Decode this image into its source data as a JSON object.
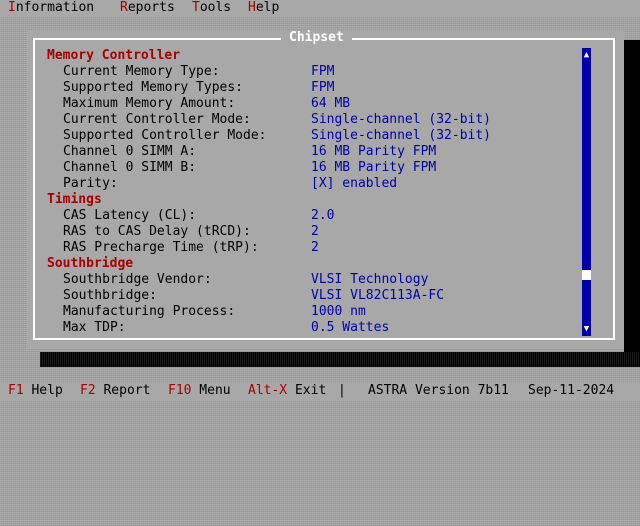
{
  "menubar": {
    "items": [
      {
        "hot": "I",
        "rest": "nformation"
      },
      {
        "hot": "R",
        "rest": "eports"
      },
      {
        "hot": "T",
        "rest": "ools"
      },
      {
        "hot": "H",
        "rest": "elp"
      }
    ]
  },
  "window": {
    "title": "Chipset",
    "sections": {
      "memory_controller": {
        "title": "Memory Controller",
        "rows": [
          {
            "label": "Current Memory Type:",
            "value": "FPM"
          },
          {
            "label": "Supported Memory Types:",
            "value": "FPM"
          },
          {
            "label": "Maximum Memory Amount:",
            "value": "64 MB"
          },
          {
            "label": "Current Controller Mode:",
            "value": "Single-channel (32-bit)"
          },
          {
            "label": "Supported Controller Mode:",
            "value": "Single-channel (32-bit)"
          },
          {
            "label": "Channel 0 SIMM A:",
            "value": "16 MB Parity FPM"
          },
          {
            "label": "Channel 0 SIMM B:",
            "value": "16 MB Parity FPM"
          },
          {
            "label": "Parity:",
            "value": "[X] enabled"
          }
        ]
      },
      "timings": {
        "title": "Timings",
        "rows": [
          {
            "label": "CAS Latency (CL):",
            "value": "2.0"
          },
          {
            "label": "RAS to CAS Delay (tRCD):",
            "value": "2"
          },
          {
            "label": "RAS Precharge Time (tRP):",
            "value": "2"
          }
        ]
      },
      "southbridge": {
        "title": "Southbridge",
        "rows": [
          {
            "label": "Southbridge Vendor:",
            "value": "VLSI Technology"
          },
          {
            "label": "Southbridge:",
            "value": "VLSI VL82C113A-FC"
          },
          {
            "label": "Manufacturing Process:",
            "value": "1000 nm"
          },
          {
            "label": "Max TDP:",
            "value": "0.5 Wattes"
          }
        ]
      }
    }
  },
  "statusbar": {
    "shortcuts": [
      {
        "key": "F1",
        "label": " Help"
      },
      {
        "key": "F2",
        "label": " Report"
      },
      {
        "key": "F10",
        "label": " Menu"
      },
      {
        "key": "Alt-X",
        "label": " Exit"
      }
    ],
    "separator": "|",
    "version": "ASTRA Version 7b11",
    "date": "Sep-11-2024"
  },
  "colors": {
    "background": "#a8a8a8",
    "section_heading": "#a80000",
    "value_text": "#0000a8",
    "hotkey": "#a80000",
    "scrollbar": "#0000a8"
  },
  "icons": {
    "scroll_up": "triangle-up-icon",
    "scroll_down": "triangle-down-icon"
  }
}
